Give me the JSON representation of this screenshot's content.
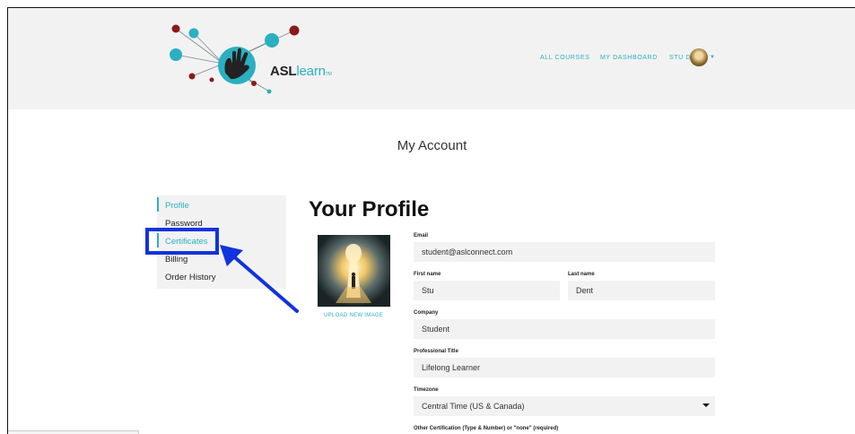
{
  "header": {
    "logo_text_bold": "ASL",
    "logo_text_light": "learn",
    "logo_tm": "TM",
    "nav": {
      "all_courses": "ALL COURSES",
      "my_dashboard": "MY DASHBOARD",
      "user": "STU D"
    }
  },
  "page": {
    "title": "My Account"
  },
  "sidebar": {
    "items": [
      {
        "label": "Profile",
        "active": true
      },
      {
        "label": "Password",
        "active": false
      },
      {
        "label": "Certificates",
        "active": false
      },
      {
        "label": "Billing",
        "active": false
      },
      {
        "label": "Order History",
        "active": false
      }
    ]
  },
  "profile": {
    "heading": "Your Profile",
    "upload_label": "UPLOAD NEW IMAGE",
    "fields": {
      "email_label": "Email",
      "email_value": "student@aslconnect.com",
      "first_name_label": "First name",
      "first_name_value": "Stu",
      "last_name_label": "Last name",
      "last_name_value": "Dent",
      "company_label": "Company",
      "company_value": "Student",
      "title_label": "Professional Title",
      "title_value": "Lifelong Learner",
      "timezone_label": "Timezone",
      "timezone_value": "Central Time (US & Canada)",
      "other_cert_label": "Other Certification (Type & Number) or \"none\" (required)"
    }
  },
  "colors": {
    "accent": "#2ab0c0",
    "highlight": "#1133dd",
    "logo_dark_red": "#8b1a1a"
  }
}
